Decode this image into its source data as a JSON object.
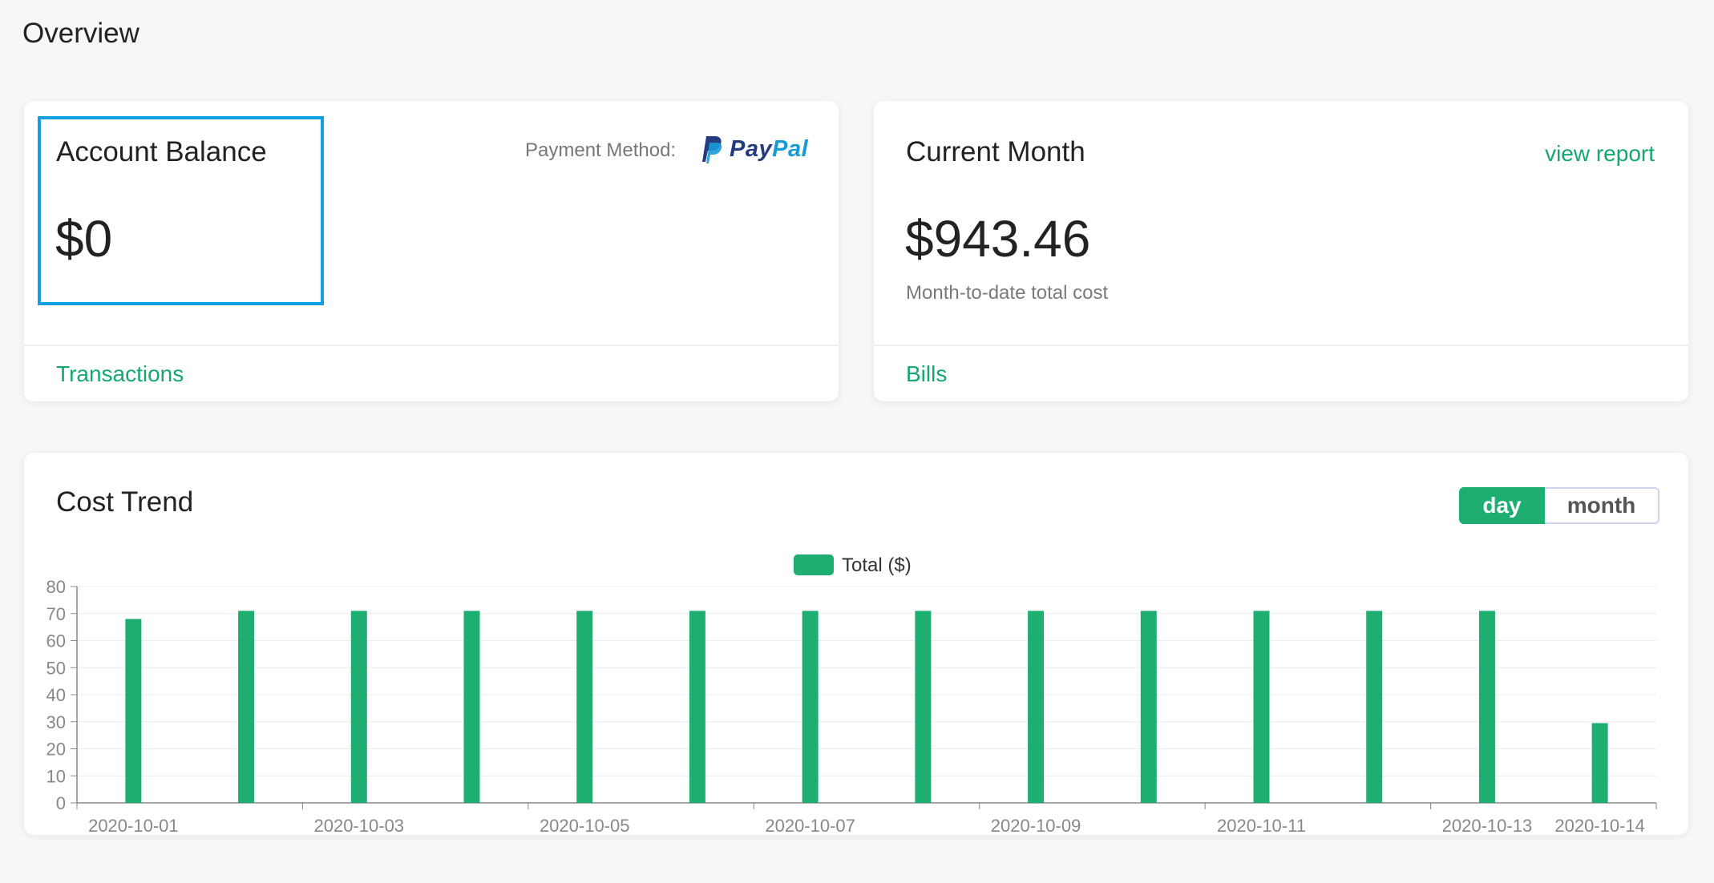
{
  "page": {
    "title": "Overview"
  },
  "balance_card": {
    "title": "Account Balance",
    "amount": "$0",
    "payment_method_label": "Payment Method:",
    "payment_logo": {
      "name": "paypal-logo",
      "text_pay": "Pay",
      "text_pal": "Pal"
    },
    "link": "Transactions"
  },
  "month_card": {
    "title": "Current Month",
    "view_report": "view report",
    "amount": "$943.46",
    "subtext": "Month-to-date total cost",
    "link": "Bills"
  },
  "trend_card": {
    "title": "Cost Trend",
    "toggle": {
      "day": "day",
      "month": "month",
      "selected": "day"
    }
  },
  "colors": {
    "accent": "#14a86e",
    "bar": "#1fae72",
    "highlight_border": "#159fe3",
    "paypal_dark": "#253b80",
    "paypal_light": "#179bd7"
  },
  "chart_data": {
    "type": "bar",
    "categories": [
      "2020-10-01",
      "2020-10-02",
      "2020-10-03",
      "2020-10-04",
      "2020-10-05",
      "2020-10-06",
      "2020-10-07",
      "2020-10-08",
      "2020-10-09",
      "2020-10-10",
      "2020-10-11",
      "2020-10-12",
      "2020-10-13",
      "2020-10-14"
    ],
    "tick_labels": [
      "2020-10-01",
      "2020-10-03",
      "2020-10-05",
      "2020-10-07",
      "2020-10-09",
      "2020-10-11",
      "2020-10-13",
      "2020-10-14"
    ],
    "series": [
      {
        "name": "Total ($)",
        "values": [
          68,
          71,
          71,
          71,
          71,
          71,
          71,
          71,
          71,
          71,
          71,
          71,
          71,
          29.5
        ]
      }
    ],
    "ylim": [
      0,
      80
    ],
    "yticks": [
      0,
      10,
      20,
      30,
      40,
      50,
      60,
      70,
      80
    ],
    "grid": true,
    "legend": "top-center"
  }
}
